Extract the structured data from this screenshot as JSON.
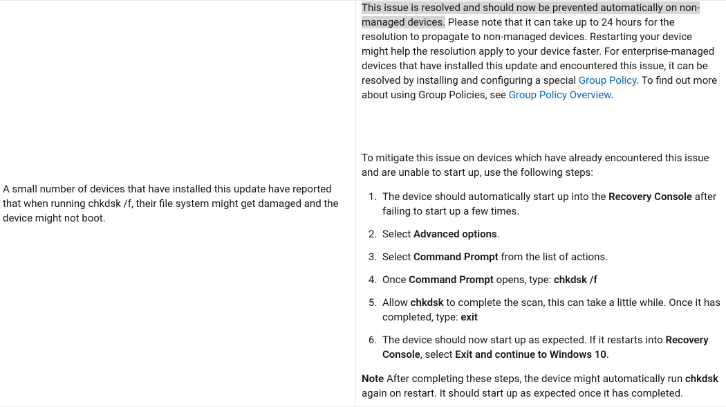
{
  "left": {
    "summary": "A small number of devices that have installed this update have reported that when running chkdsk /f, their file system might get damaged and the device might not boot."
  },
  "right": {
    "resolved_highlight": "This issue is resolved and should now be prevented automatically on non-managed devices.",
    "resolved_rest_a": " Please note that it can take up to 24 hours for the resolution to propagate to non-managed devices. Restarting your device might help the resolution apply to your device faster. For enterprise-managed devices that have installed this update and encountered this issue, it can be resolved by installing and configuring a special ",
    "link1": "Group Policy",
    "resolved_rest_b": ". To find out more about using Group Policies, see ",
    "link2": "Group Policy Overview",
    "resolved_rest_c": ".",
    "mitigate_intro": "To mitigate this issue on devices which have already encountered this issue and are unable to start up, use the following steps:",
    "steps": {
      "s1a": "The device should automatically start up into the ",
      "s1b": "Recovery Console",
      "s1c": " after failing to start up a few times.",
      "s2a": "Select ",
      "s2b": "Advanced options",
      "s2c": ".",
      "s3a": "Select ",
      "s3b": "Command Prompt",
      "s3c": " from the list of actions.",
      "s4a": "Once ",
      "s4b": "Command Prompt",
      "s4c": " opens, type: ",
      "s4d": "chkdsk /f",
      "s5a": "Allow ",
      "s5b": "chkdsk",
      "s5c": " to complete the scan, this can take a little while. Once it has completed, type: ",
      "s5d": "exit",
      "s6a": "The device should now start up as expected. If it restarts into ",
      "s6b": "Recovery Console",
      "s6c": ", select ",
      "s6d": "Exit and continue to Windows 10",
      "s6e": "."
    },
    "note_label": "Note",
    "note_a": " After completing these steps, the device might automatically run ",
    "note_b": "chkdsk",
    "note_c": " again on restart. It should start up as expected once it has completed."
  }
}
